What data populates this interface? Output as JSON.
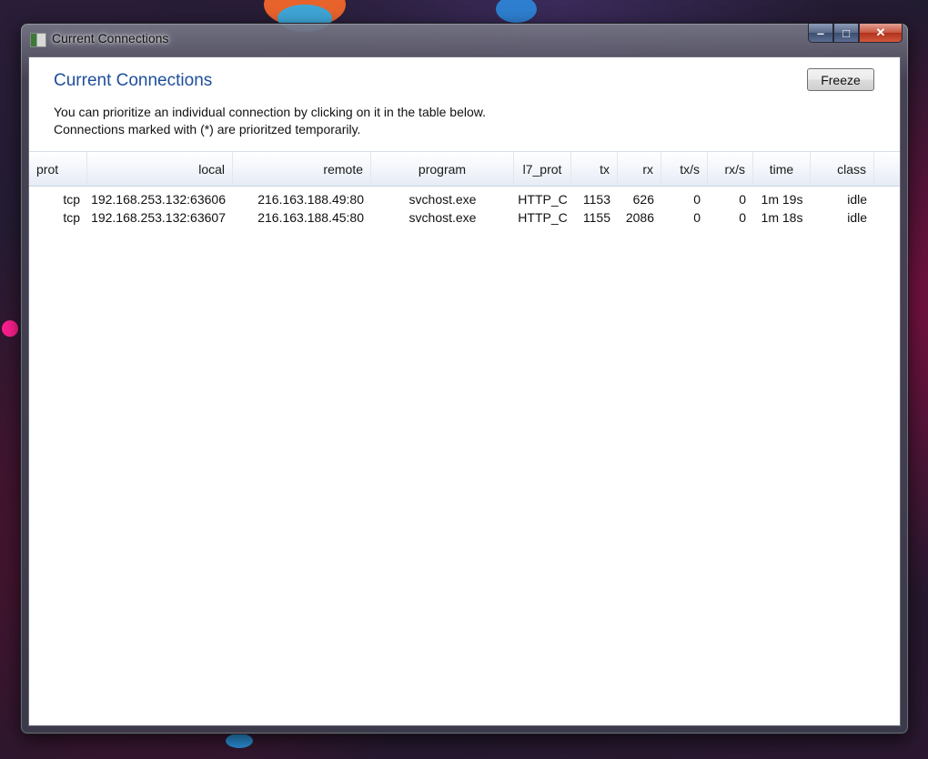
{
  "window": {
    "title": "Current Connections",
    "minimize_label": "‒",
    "maximize_label": "□",
    "close_label": "✕"
  },
  "content": {
    "heading": "Current Connections",
    "description_line1": "You can prioritize an individual connection by clicking on it in the table below.",
    "description_line2": "Connections marked with (*) are prioritzed temporarily.",
    "freeze_label": "Freeze"
  },
  "table": {
    "columns": [
      "prot",
      "local",
      "remote",
      "program",
      "l7_prot",
      "tx",
      "rx",
      "tx/s",
      "rx/s",
      "time",
      "class"
    ],
    "rows": [
      [
        "tcp",
        "192.168.253.132:63606",
        "216.163.188.49:80",
        "svchost.exe",
        "HTTP_C",
        "1153",
        "626",
        "0",
        "0",
        "1m 19s",
        "idle"
      ],
      [
        "tcp",
        "192.168.253.132:63607",
        "216.163.188.45:80",
        "svchost.exe",
        "HTTP_C",
        "1155",
        "2086",
        "0",
        "0",
        "1m 18s",
        "idle"
      ]
    ]
  },
  "colors": {
    "heading": "#1e4e9c",
    "header_bg": "#e6ecf5"
  }
}
